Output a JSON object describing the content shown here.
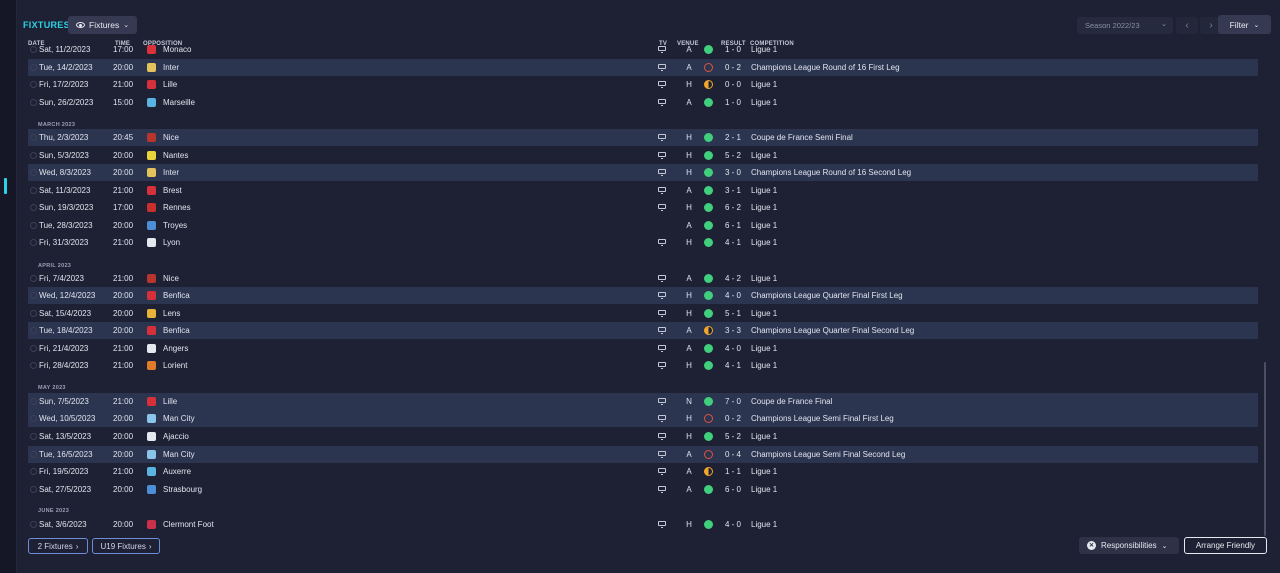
{
  "header": {
    "title": "FIXTURES",
    "view_label": "Fixtures",
    "season_label": "Season 2022/23",
    "filter_label": "Filter"
  },
  "columns": {
    "date": "DATE",
    "time": "TIME",
    "opposition": "OPPOSITION",
    "tv": "TV",
    "venue": "VENUE",
    "result": "RESULT",
    "competition": "COMPETITION"
  },
  "months": {
    "march": "MARCH 2023",
    "april": "APRIL 2023",
    "may": "MAY 2023",
    "june": "JUNE 2023"
  },
  "fixtures": [
    {
      "date": "Sat, 11/2/2023",
      "time": "17:00",
      "opp": "Monaco",
      "tv": true,
      "venue": "A",
      "outcome": "win",
      "result": "1 - 0",
      "comp": "Ligue 1",
      "crest": "#d9323b"
    },
    {
      "date": "Tue, 14/2/2023",
      "time": "20:00",
      "opp": "Inter",
      "tv": true,
      "venue": "A",
      "outcome": "loss",
      "result": "0 - 2",
      "comp": "Champions League Round of 16 First Leg",
      "crest": "#e3c15b"
    },
    {
      "date": "Fri, 17/2/2023",
      "time": "21:00",
      "opp": "Lille",
      "tv": true,
      "venue": "H",
      "outcome": "draw",
      "result": "0 - 0",
      "comp": "Ligue 1",
      "crest": "#d6303a"
    },
    {
      "date": "Sun, 26/2/2023",
      "time": "15:00",
      "opp": "Marseille",
      "tv": true,
      "venue": "A",
      "outcome": "win",
      "result": "1 - 0",
      "comp": "Ligue 1",
      "crest": "#5ab3e0"
    },
    {
      "date": "Thu, 2/3/2023",
      "time": "20:45",
      "opp": "Nice",
      "tv": true,
      "venue": "H",
      "outcome": "win",
      "result": "2 - 1",
      "comp": "Coupe de France Semi Final",
      "crest": "#b8352e"
    },
    {
      "date": "Sun, 5/3/2023",
      "time": "20:00",
      "opp": "Nantes",
      "tv": true,
      "venue": "H",
      "outcome": "win",
      "result": "5 - 2",
      "comp": "Ligue 1",
      "crest": "#e8d33a"
    },
    {
      "date": "Wed, 8/3/2023",
      "time": "20:00",
      "opp": "Inter",
      "tv": true,
      "venue": "H",
      "outcome": "win",
      "result": "3 - 0",
      "comp": "Champions League Round of 16 Second Leg",
      "crest": "#e3c15b"
    },
    {
      "date": "Sat, 11/3/2023",
      "time": "21:00",
      "opp": "Brest",
      "tv": true,
      "venue": "A",
      "outcome": "win",
      "result": "3 - 1",
      "comp": "Ligue 1",
      "crest": "#d6303a"
    },
    {
      "date": "Sun, 19/3/2023",
      "time": "17:00",
      "opp": "Rennes",
      "tv": true,
      "venue": "H",
      "outcome": "win",
      "result": "6 - 2",
      "comp": "Ligue 1",
      "crest": "#c9302c"
    },
    {
      "date": "Tue, 28/3/2023",
      "time": "20:00",
      "opp": "Troyes",
      "tv": false,
      "venue": "A",
      "outcome": "win",
      "result": "6 - 1",
      "comp": "Ligue 1",
      "crest": "#4d8fd6"
    },
    {
      "date": "Fri, 31/3/2023",
      "time": "21:00",
      "opp": "Lyon",
      "tv": true,
      "venue": "H",
      "outcome": "win",
      "result": "4 - 1",
      "comp": "Ligue 1",
      "crest": "#e6e8ef"
    },
    {
      "date": "Fri, 7/4/2023",
      "time": "21:00",
      "opp": "Nice",
      "tv": true,
      "venue": "A",
      "outcome": "win",
      "result": "4 - 2",
      "comp": "Ligue 1",
      "crest": "#b8352e"
    },
    {
      "date": "Wed, 12/4/2023",
      "time": "20:00",
      "opp": "Benfica",
      "tv": true,
      "venue": "H",
      "outcome": "win",
      "result": "4 - 0",
      "comp": "Champions League Quarter Final First Leg",
      "crest": "#d6303a"
    },
    {
      "date": "Sat, 15/4/2023",
      "time": "20:00",
      "opp": "Lens",
      "tv": true,
      "venue": "H",
      "outcome": "win",
      "result": "5 - 1",
      "comp": "Ligue 1",
      "crest": "#e8b23a"
    },
    {
      "date": "Tue, 18/4/2023",
      "time": "20:00",
      "opp": "Benfica",
      "tv": true,
      "venue": "A",
      "outcome": "draw",
      "result": "3 - 3",
      "comp": "Champions League Quarter Final Second Leg",
      "crest": "#d6303a"
    },
    {
      "date": "Fri, 21/4/2023",
      "time": "21:00",
      "opp": "Angers",
      "tv": true,
      "venue": "A",
      "outcome": "win",
      "result": "4 - 0",
      "comp": "Ligue 1",
      "crest": "#e6e8ef"
    },
    {
      "date": "Fri, 28/4/2023",
      "time": "21:00",
      "opp": "Lorient",
      "tv": true,
      "venue": "H",
      "outcome": "win",
      "result": "4 - 1",
      "comp": "Ligue 1",
      "crest": "#e07b2a"
    },
    {
      "date": "Sun, 7/5/2023",
      "time": "21:00",
      "opp": "Lille",
      "tv": true,
      "venue": "N",
      "outcome": "win",
      "result": "7 - 0",
      "comp": "Coupe de France Final",
      "crest": "#d6303a"
    },
    {
      "date": "Wed, 10/5/2023",
      "time": "20:00",
      "opp": "Man City",
      "tv": true,
      "venue": "H",
      "outcome": "loss",
      "result": "0 - 2",
      "comp": "Champions League Semi Final First Leg",
      "crest": "#8ac4ea"
    },
    {
      "date": "Sat, 13/5/2023",
      "time": "20:00",
      "opp": "Ajaccio",
      "tv": true,
      "venue": "H",
      "outcome": "win",
      "result": "5 - 2",
      "comp": "Ligue 1",
      "crest": "#e6e8ef"
    },
    {
      "date": "Tue, 16/5/2023",
      "time": "20:00",
      "opp": "Man City",
      "tv": true,
      "venue": "A",
      "outcome": "loss",
      "result": "0 - 4",
      "comp": "Champions League Semi Final Second Leg",
      "crest": "#8ac4ea"
    },
    {
      "date": "Fri, 19/5/2023",
      "time": "21:00",
      "opp": "Auxerre",
      "tv": true,
      "venue": "A",
      "outcome": "draw",
      "result": "1 - 1",
      "comp": "Ligue 1",
      "crest": "#5ab3e0"
    },
    {
      "date": "Sat, 27/5/2023",
      "time": "20:00",
      "opp": "Strasbourg",
      "tv": true,
      "venue": "A",
      "outcome": "win",
      "result": "6 - 0",
      "comp": "Ligue 1",
      "crest": "#4d8fd6"
    },
    {
      "date": "Sat, 3/6/2023",
      "time": "20:00",
      "opp": "Clermont Foot",
      "tv": true,
      "venue": "H",
      "outcome": "win",
      "result": "4 - 0",
      "comp": "Ligue 1",
      "crest": "#c9304a"
    }
  ],
  "footer": {
    "fixtures_link": "2 Fixtures",
    "u19_link": "U19 Fixtures",
    "responsibilities": "Responsibilities",
    "arrange": "Arrange Friendly"
  },
  "colors": {
    "accent": "#2ad3e6",
    "win": "#3fcf7d",
    "loss": "#e0533d",
    "draw": "#f3a72a"
  }
}
